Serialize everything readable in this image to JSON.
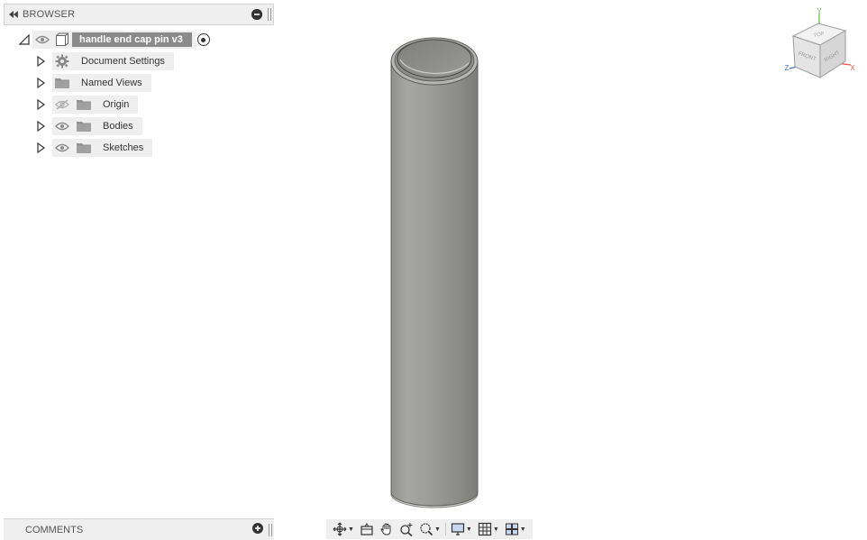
{
  "browser": {
    "title": "BROWSER",
    "collapse_icon": "double-left-arrow",
    "minimize_icon": "minus-circle",
    "root": {
      "label": "handle end cap pin v3",
      "visible": true
    },
    "items": [
      {
        "label": "Document Settings",
        "icon": "gear-icon",
        "has_eye": false
      },
      {
        "label": "Named Views",
        "icon": "folder-icon",
        "has_eye": false
      },
      {
        "label": "Origin",
        "icon": "folder-icon",
        "has_eye": true,
        "visible": false
      },
      {
        "label": "Bodies",
        "icon": "folder-icon",
        "has_eye": true,
        "visible": true
      },
      {
        "label": "Sketches",
        "icon": "folder-icon",
        "has_eye": true,
        "visible": true
      }
    ]
  },
  "comments": {
    "title": "COMMENTS",
    "add_icon": "plus-circle"
  },
  "viewcube": {
    "faces": {
      "top": "TOP",
      "front": "FRONT",
      "right": "RIGHT"
    },
    "axes": {
      "x": "X",
      "y": "Y",
      "z": "Z"
    },
    "colors": {
      "x": "#e8563f",
      "y": "#5bc236",
      "z": "#3a6fd8"
    }
  },
  "toolbar": {
    "tools": [
      "orbit-icon",
      "look-at-icon",
      "pan-icon",
      "zoom-icon",
      "fit-icon",
      "display-settings-icon",
      "grid-icon",
      "viewports-icon"
    ]
  },
  "colors": {
    "panel_bg": "#efefef",
    "root_label_bg": "#8a8a8a",
    "body_gray": "#9a9a96"
  }
}
